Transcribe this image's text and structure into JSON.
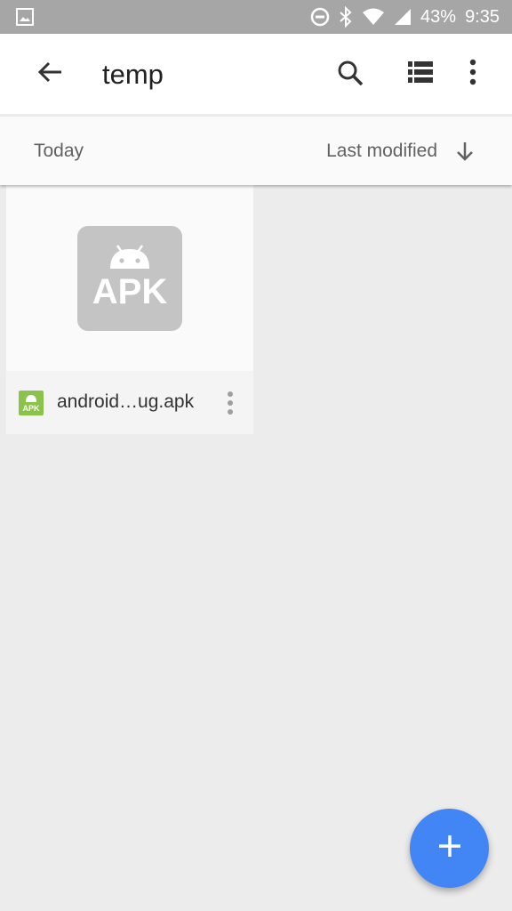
{
  "status_bar": {
    "battery_text": "43%",
    "time": "9:35",
    "icons": [
      "image-icon",
      "do-not-disturb-icon",
      "bluetooth-icon",
      "wifi-icon",
      "cell-signal-icon"
    ]
  },
  "app_bar": {
    "title": "temp",
    "icons": [
      "back-arrow-icon",
      "search-icon",
      "list-view-icon",
      "more-vert-icon"
    ]
  },
  "sort_bar": {
    "group_label": "Today",
    "sort_label": "Last modified",
    "sort_direction_icon": "arrow-down-icon"
  },
  "files": [
    {
      "name": "android…ug.apk",
      "thumbnail_text": "APK",
      "type_icon_text": "APK"
    }
  ],
  "fab": {
    "icon": "plus-icon"
  },
  "colors": {
    "status_bar": "#a6a6a6",
    "background": "#ececec",
    "fab": "#4285f4",
    "apk_green": "#8bc34a"
  }
}
